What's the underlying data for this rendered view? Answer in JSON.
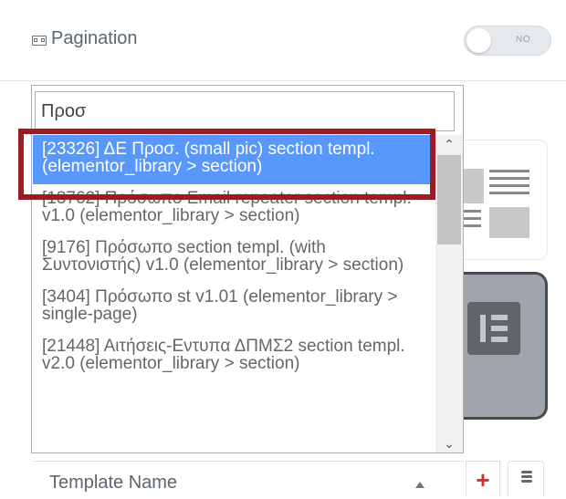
{
  "header": {
    "pagination_label": "Pagination",
    "toggle_text": "NO"
  },
  "dropdown": {
    "search_value": "Προσ",
    "results": [
      {
        "label": "[23326] ΔΕ Προσ. (small pic) section templ. (elementor_library > section)",
        "selected": true
      },
      {
        "label": "[13762] Πρόσωπο Email repeater section templ. v1.0 (elementor_library > section)",
        "selected": false
      },
      {
        "label": "[9176] Πρόσωπο section templ. (with Συντονιστής) v1.0 (elementor_library > section)",
        "selected": false
      },
      {
        "label": "[3404] Πρόσωπο st v1.01 (elementor_library > single-page)",
        "selected": false
      },
      {
        "label": "[21448] Αιτήσεις-Εντυπα ΔΠΜΣ2 section templ. v2.0 (elementor_library > section)",
        "selected": false
      }
    ]
  },
  "footer": {
    "template_label": "Template Name",
    "add_symbol": "+"
  },
  "colors": {
    "selection": "#5897fb",
    "highlight_border": "#9b1c22",
    "add_red": "#d32f2f"
  },
  "icons": [
    "pagination-icon",
    "scroll-up-icon",
    "scroll-down-icon",
    "caret-up-icon",
    "plus-icon",
    "database-icon",
    "elementor-logo-icon"
  ]
}
